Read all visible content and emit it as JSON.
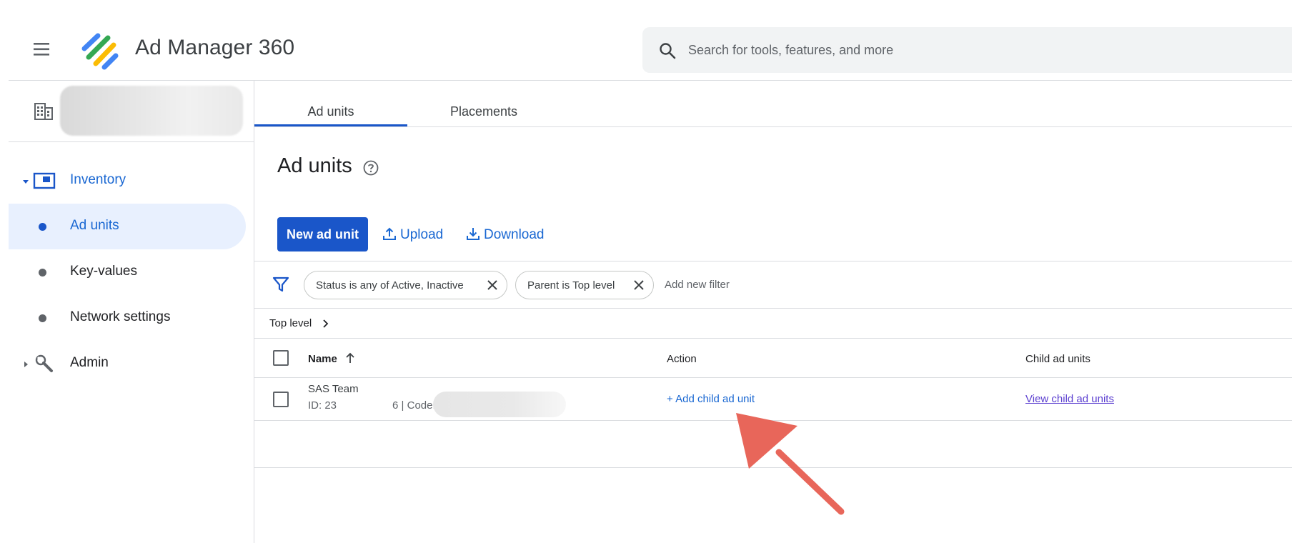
{
  "header": {
    "app_title": "Ad Manager 360",
    "search_placeholder": "Search for tools, features, and more",
    "icons": [
      "menu-icon",
      "search-icon"
    ]
  },
  "sidebar": {
    "network_icon": "building-icon",
    "items": [
      {
        "label": "Inventory",
        "icon": "inventory-icon",
        "expanded": true
      },
      {
        "label": "Ad units",
        "active": true
      },
      {
        "label": "Key-values"
      },
      {
        "label": "Network settings"
      },
      {
        "label": "Admin",
        "icon": "wrench-icon",
        "expanded": false
      }
    ]
  },
  "tabs": [
    {
      "label": "Ad units",
      "selected": true
    },
    {
      "label": "Placements",
      "selected": false
    }
  ],
  "page": {
    "title": "Ad units",
    "actions": {
      "new_label": "New ad unit",
      "upload_label": "Upload",
      "download_label": "Download"
    },
    "filters": {
      "chips": [
        {
          "label": "Status is any of Active, Inactive"
        },
        {
          "label": "Parent is Top level"
        }
      ],
      "add_label": "Add new filter"
    },
    "breadcrumb": "Top level",
    "table": {
      "columns": [
        "Name",
        "Action",
        "Child ad units"
      ],
      "sort_column": "Name",
      "sort_direction": "ascending",
      "rows": [
        {
          "name": "SAS Team",
          "id_prefix": "ID: 23",
          "id_suffix": "6 | Code:",
          "action": "+ Add child ad unit",
          "children_link": "View child ad units"
        }
      ]
    }
  },
  "colors": {
    "accent": "#1a56c9",
    "link": "#1967d2",
    "active_nav_bg": "#e8f0fe",
    "annotation_arrow": "#e8665a"
  }
}
